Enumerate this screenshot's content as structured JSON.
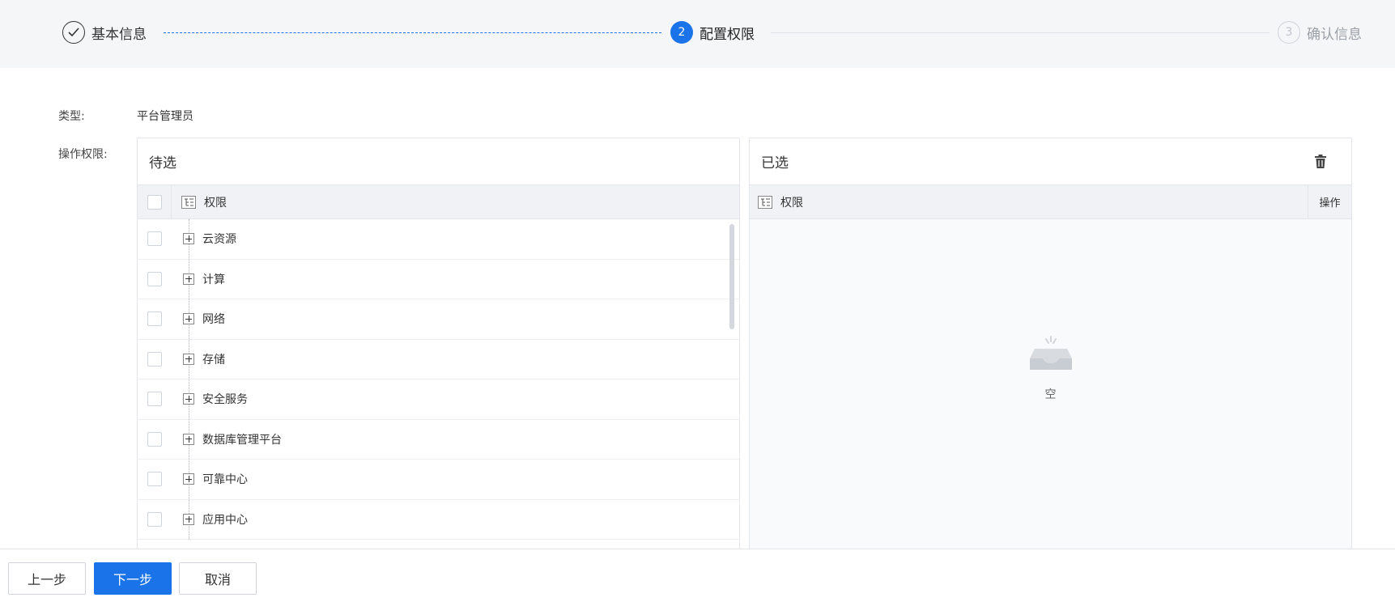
{
  "steps": [
    {
      "number": "",
      "label": "基本信息",
      "state": "done"
    },
    {
      "number": "2",
      "label": "配置权限",
      "state": "active"
    },
    {
      "number": "3",
      "label": "确认信息",
      "state": "pending"
    }
  ],
  "form": {
    "type_label": "类型:",
    "type_value": "平台管理员",
    "perm_label": "操作权限:"
  },
  "left_panel": {
    "title": "待选",
    "column_header": "权限",
    "items": [
      "云资源",
      "计算",
      "网络",
      "存储",
      "安全服务",
      "数据库管理平台",
      "可靠中心",
      "应用中心"
    ]
  },
  "right_panel": {
    "title": "已选",
    "column_header": "权限",
    "op_header": "操作",
    "empty_text": "空"
  },
  "footer": {
    "prev_label": "上一步",
    "next_label": "下一步",
    "cancel_label": "取消"
  },
  "colors": {
    "primary": "#1a73e8",
    "step_bar_bg": "#f5f6f8"
  },
  "icons": {
    "step1": "check-icon",
    "tree": "tree-list-icon",
    "expand": "plus-square-icon",
    "clear": "trash-icon",
    "empty": "empty-inbox-icon"
  }
}
